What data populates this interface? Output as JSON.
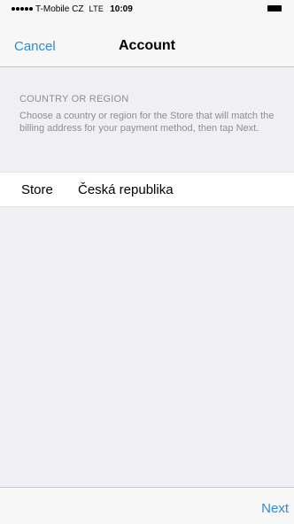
{
  "status_bar": {
    "carrier": "T-Mobile CZ",
    "network": "LTE",
    "time": "10:09"
  },
  "nav": {
    "cancel_label": "Cancel",
    "title": "Account"
  },
  "section": {
    "header": "COUNTRY OR REGION",
    "description": "Choose a country or region for the Store that will match the billing address for your payment method, then tap Next."
  },
  "store": {
    "label": "Store",
    "value": "Česká republika"
  },
  "toolbar": {
    "next_label": "Next"
  },
  "colors": {
    "accent": "#2e8bd9",
    "background": "#efeff4",
    "secondary_text": "#8e8e93"
  }
}
